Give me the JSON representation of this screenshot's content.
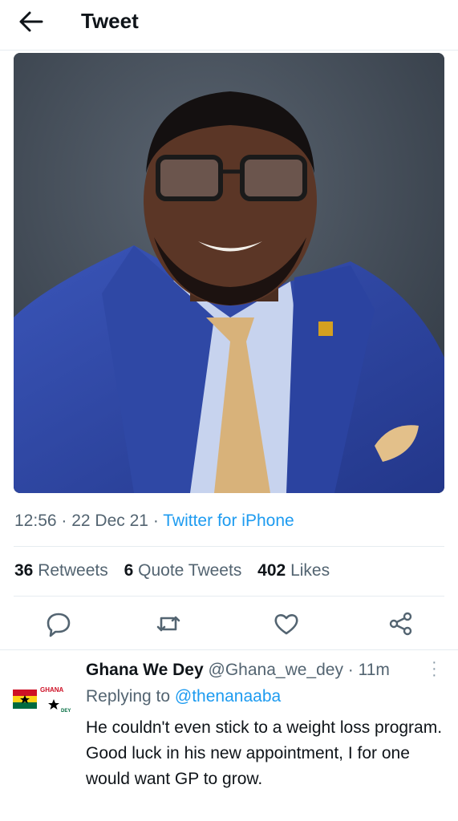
{
  "header": {
    "title": "Tweet",
    "back_icon": "arrow-left-icon"
  },
  "tweet": {
    "time": "12:56",
    "date": "22 Dec 21",
    "source": "Twitter for iPhone",
    "retweets_count": "36",
    "retweets_label": "Retweets",
    "quotes_count": "6",
    "quotes_label": "Quote Tweets",
    "likes_count": "402",
    "likes_label": "Likes",
    "actions": [
      "reply-icon",
      "retweet-icon",
      "like-icon",
      "share-icon"
    ]
  },
  "reply": {
    "name": "Ghana We Dey",
    "handle": "@Ghana_we_dey",
    "time": "11m",
    "replying_prefix": "Replying to",
    "replying_to": "@thenanaaba",
    "text": "He couldn't even stick to a weight loss program.  Good luck in his new appointment, I for one would want GP to grow.",
    "avatar_text": "GHANA",
    "avatar_subtext": "DEY"
  },
  "colors": {
    "link": "#1d9bf0",
    "secondary": "#536471",
    "border": "#e6ecf0"
  }
}
